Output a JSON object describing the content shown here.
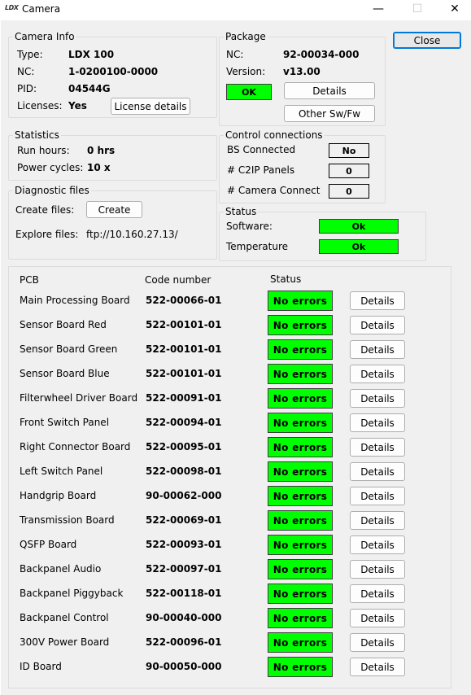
{
  "window": {
    "logo": "LDX",
    "title": "Camera",
    "minimize": "—",
    "maximize": "☐",
    "close": "✕"
  },
  "close_button": "Close",
  "camera_info": {
    "legend": "Camera Info",
    "type_label": "Type:",
    "type_value": "LDX 100",
    "nc_label": "NC:",
    "nc_value": "1-0200100-0000",
    "pid_label": "PID:",
    "pid_value": "04544G",
    "licenses_label": "Licenses:",
    "licenses_value": "Yes",
    "license_details_button": "License details"
  },
  "package": {
    "legend": "Package",
    "nc_label": "NC:",
    "nc_value": "92-00034-000",
    "version_label": "Version:",
    "version_value": "v13.00",
    "ok_status": "OK",
    "details_button": "Details",
    "other_sw_button": "Other Sw/Fw"
  },
  "statistics": {
    "legend": "Statistics",
    "run_hours_label": "Run hours:",
    "run_hours_value": "0 hrs",
    "power_cycles_label": "Power cycles:",
    "power_cycles_value": "10 x"
  },
  "control": {
    "legend": "Control connections",
    "bs_label": "BS Connected",
    "bs_value": "No",
    "c2ip_label": "# C2IP Panels",
    "c2ip_value": "0",
    "cam_label": "# Camera Connect",
    "cam_value": "0"
  },
  "diagnostic": {
    "legend": "Diagnostic files",
    "create_label": "Create files:",
    "create_button": "Create",
    "explore_label": "Explore files:",
    "explore_value": "ftp://10.160.27.13/"
  },
  "status": {
    "legend": "Status",
    "software_label": "Software:",
    "software_value": "Ok",
    "temperature_label": "Temperature",
    "temperature_value": "Ok"
  },
  "pcb": {
    "header_pcb": "PCB",
    "header_code": "Code number",
    "header_status": "Status",
    "rows": [
      {
        "name": "Main Processing Board",
        "code": "522-00066-01",
        "status": "No errors",
        "details": "Details"
      },
      {
        "name": "Sensor Board Red",
        "code": "522-00101-01",
        "status": "No errors",
        "details": "Details"
      },
      {
        "name": "Sensor Board Green",
        "code": "522-00101-01",
        "status": "No errors",
        "details": "Details"
      },
      {
        "name": "Sensor Board Blue",
        "code": "522-00101-01",
        "status": "No errors",
        "details": "Details"
      },
      {
        "name": "Filterwheel Driver Board",
        "code": "522-00091-01",
        "status": "No errors",
        "details": "Details"
      },
      {
        "name": "Front Switch Panel",
        "code": "522-00094-01",
        "status": "No errors",
        "details": "Details"
      },
      {
        "name": "Right Connector Board",
        "code": "522-00095-01",
        "status": "No errors",
        "details": "Details"
      },
      {
        "name": "Left Switch Panel",
        "code": "522-00098-01",
        "status": "No errors",
        "details": "Details"
      },
      {
        "name": "Handgrip Board",
        "code": "90-00062-000",
        "status": "No errors",
        "details": "Details"
      },
      {
        "name": "Transmission Board",
        "code": "522-00069-01",
        "status": "No errors",
        "details": "Details"
      },
      {
        "name": "QSFP Board",
        "code": "522-00093-01",
        "status": "No errors",
        "details": "Details"
      },
      {
        "name": "Backpanel Audio",
        "code": "522-00097-01",
        "status": "No errors",
        "details": "Details"
      },
      {
        "name": "Backpanel Piggyback",
        "code": "522-00118-01",
        "status": "No errors",
        "details": "Details"
      },
      {
        "name": "Backpanel Control",
        "code": "90-00040-000",
        "status": "No errors",
        "details": "Details"
      },
      {
        "name": "300V Power Board",
        "code": "522-00096-01",
        "status": "No errors",
        "details": "Details"
      },
      {
        "name": "ID Board",
        "code": "90-00050-000",
        "status": "No errors",
        "details": "Details"
      }
    ]
  },
  "colors": {
    "ok_green": "#00ff00",
    "dialog_background": "#f0f0f0",
    "focus_blue": "#0078d7"
  }
}
